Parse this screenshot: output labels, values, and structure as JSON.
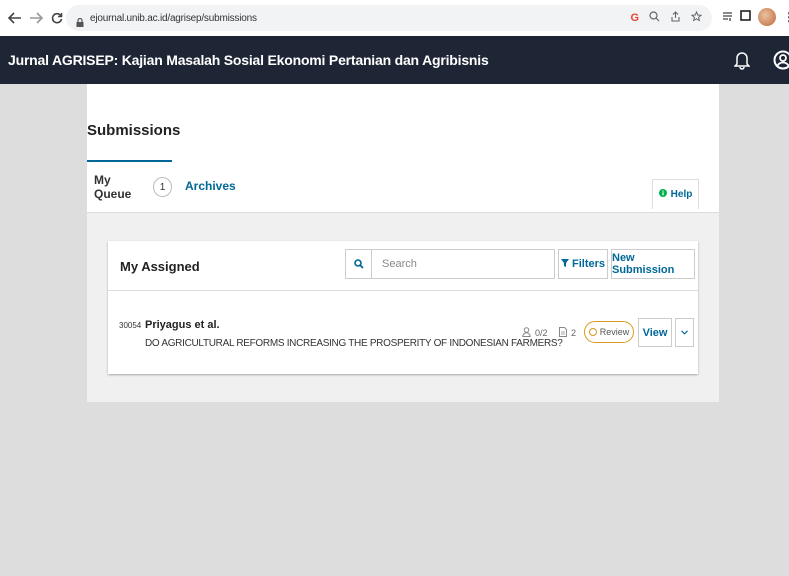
{
  "browser": {
    "url": "ejournal.unib.ac.id/agrisep/submissions"
  },
  "header": {
    "site_title": "Jurnal AGRISEP: Kajian Masalah Sosial Ekonomi Pertanian dan Agribisnis"
  },
  "page": {
    "title": "Submissions",
    "tabs": [
      {
        "label": "My Queue",
        "count": "1"
      },
      {
        "label": "Archives"
      }
    ],
    "help_label": "Help"
  },
  "list": {
    "title": "My Assigned",
    "search_placeholder": "Search",
    "filters_label": "Filters",
    "new_submission_label": "New Submission",
    "items": [
      {
        "id": "30054",
        "authors": "Priyagus et al.",
        "title": "DO AGRICULTURAL REFORMS INCREASING THE PROSPERITY OF INDONESIAN FARMERS?",
        "reviews": "0/2",
        "files": "2",
        "stage": "Review",
        "view_label": "View"
      }
    ]
  },
  "colors": {
    "header_bg": "#1e2535",
    "link": "#006798",
    "review_accent": "#d89a20",
    "help_icon": "#00b24e"
  }
}
